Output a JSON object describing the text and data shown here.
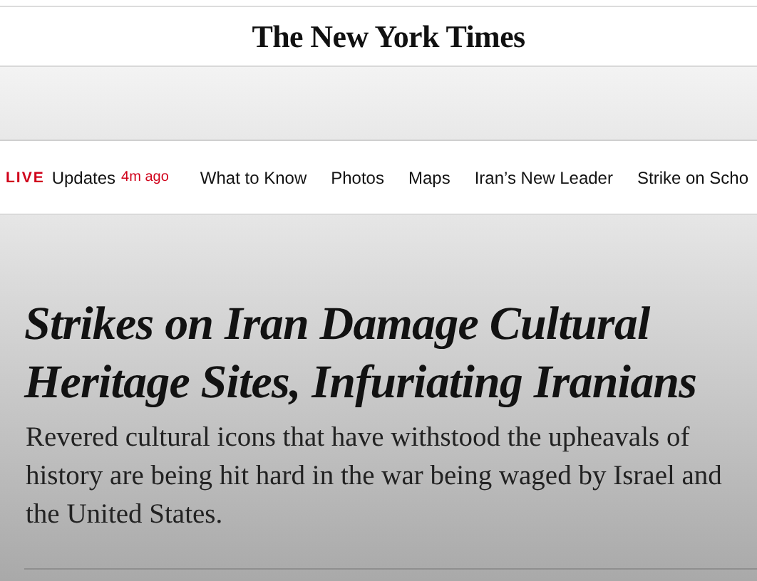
{
  "masthead": {
    "logo": "The New York Times"
  },
  "nav": {
    "live_badge": "LIVE",
    "updates_label": "Updates",
    "updated_time": "4m ago",
    "links": [
      "What to Know",
      "Photos",
      "Maps",
      "Iran’s New Leader",
      "Strike on Scho"
    ]
  },
  "article": {
    "headline": "Strikes on Iran Damage Cultural Heritage Sites, Infuriating Iranians",
    "summary": "Revered cultural icons that have withstood the upheavals of history are being hit hard in the war being waged by Israel and the United States."
  }
}
